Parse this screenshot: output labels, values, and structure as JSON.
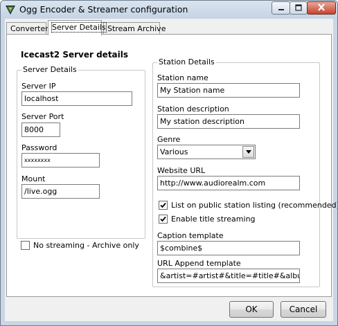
{
  "window": {
    "title": "Ogg Encoder & Streamer configuration",
    "icon": "app-logo-icon",
    "controls": [
      "minimize-icon",
      "maximize-icon",
      "close-icon"
    ]
  },
  "tabs": [
    {
      "label": "Converter",
      "active": false
    },
    {
      "label": "Server Details",
      "active": true
    },
    {
      "label": "Stream Archive",
      "active": false
    }
  ],
  "server": {
    "heading": "Icecast2 Server details",
    "group_title": "Server Details",
    "ip_label": "Server IP",
    "ip_value": "localhost",
    "port_label": "Server Port",
    "port_value": "8000",
    "password_label": "Password",
    "password_value": "xxxxxxxx",
    "mount_label": "Mount",
    "mount_value": "/live.ogg"
  },
  "no_streaming": {
    "label": "No streaming - Archive only",
    "checked": false
  },
  "station": {
    "group_title": "Station Details",
    "name_label": "Station name",
    "name_value": "My Station name",
    "description_label": "Station description",
    "description_value": "My station description",
    "genre_label": "Genre",
    "genre_value": "Various",
    "website_label": "Website URL",
    "website_value": "http://www.audiorealm.com",
    "public_listing_label": "List on public station listing (recommended)",
    "public_listing_checked": true,
    "title_streaming_label": "Enable title streaming",
    "title_streaming_checked": true,
    "caption_label": "Caption template",
    "caption_value": "$combine$",
    "url_append_label": "URL Append template",
    "url_append_value": "&artist=#artist#&title=#title#&album=#album#"
  },
  "buttons": {
    "ok": "OK",
    "cancel": "Cancel"
  }
}
